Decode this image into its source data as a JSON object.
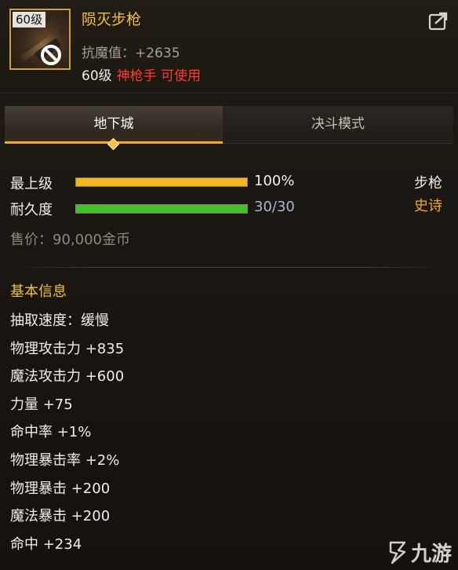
{
  "item": {
    "level_badge": "60级",
    "name": "陨灭步枪",
    "resist_label": "抗魔值：",
    "resist_value": "+2635",
    "req_level": "60级",
    "req_class": "神枪手 可使用"
  },
  "tabs": [
    {
      "label": "地下城",
      "active": true
    },
    {
      "label": "决斗模式",
      "active": false
    }
  ],
  "bars": {
    "upgrade": {
      "label": "最上级",
      "text": "100%",
      "fraction": 1.0,
      "color": "#f5b51e",
      "text_color": "#f2eee6"
    },
    "durability": {
      "label": "耐久度",
      "text": "30/30",
      "fraction": 1.0,
      "color": "#3fc22a",
      "text_color": "#a7b8cf"
    }
  },
  "weapon_type": "步枪",
  "rarity": "史诗",
  "price": "售价：90,000金币",
  "basic_info": {
    "title": "基本信息",
    "stats": [
      "抽取速度：缓慢",
      "物理攻击力 +835",
      "魔法攻击力 +600",
      "力量 +75",
      "命中率 +1%",
      "物理暴击率 +2%",
      "物理暴击 +200",
      "魔法暴击 +200",
      "命中 +234"
    ]
  },
  "watermark": "九游",
  "colors": {
    "name": "#f0c13c",
    "rarity": "#f0a92a",
    "class": "#ff3b30",
    "tab_accent": "#f0a92a"
  },
  "icons": {
    "export": "export-icon",
    "ban": "ban-icon",
    "item": "rifle-icon"
  }
}
